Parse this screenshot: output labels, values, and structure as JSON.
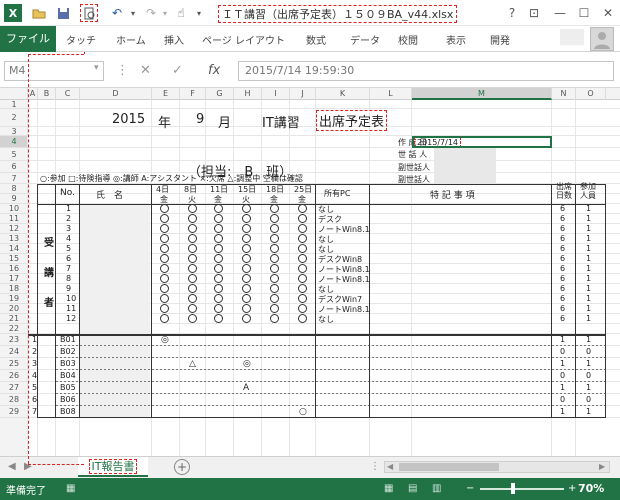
{
  "titlebar": {
    "title": "ＩＴ講習（出席予定表）１５０９BA_v44.xlsx",
    "help": "?",
    "ribbon_display": "⊡",
    "minimize": "—",
    "maximize": "☐",
    "close": "✕"
  },
  "quick_access": {
    "excel_icon": "X",
    "undo": "↶",
    "redo": "↷"
  },
  "ribbon": {
    "file": "ファイル",
    "tabs": [
      "タッチ",
      "ホーム",
      "挿入",
      "ページ レイアウト",
      "数式",
      "データ",
      "校閲",
      "表示",
      "開発"
    ]
  },
  "formula_bar": {
    "name_box": "M4",
    "fx": "fx",
    "value": "2015/7/14  19:59:30"
  },
  "columns": [
    "A",
    "B",
    "C",
    "D",
    "E",
    "F",
    "G",
    "H",
    "I",
    "J",
    "K",
    "L",
    "M",
    "N",
    "O"
  ],
  "rows": [
    "1",
    "2",
    "3",
    "4",
    "5",
    "6",
    "7",
    "8",
    "9",
    "10",
    "11",
    "12",
    "13",
    "14",
    "15",
    "16",
    "17",
    "18",
    "19",
    "20",
    "21",
    "22",
    "23",
    "24",
    "25",
    "26",
    "27",
    "28",
    "29"
  ],
  "sheet": {
    "year": "2015",
    "year_suffix": "年",
    "month": "9",
    "month_suffix": "月",
    "course": "IT講習",
    "schedule_title": "出席予定表",
    "tanto": "（担当:　B　班）",
    "info_labels": [
      "作 成 日",
      "世 話 人",
      "副世話人",
      "副世話人"
    ],
    "created_date": "2015/7/14",
    "legend": "○:参加 □:待険指導 ◎:講師 A:アシスタント ×:欠席 △:調整中 空欄は確認",
    "hdr_no": "No.",
    "hdr_name": "氏　名",
    "dates": [
      "4日",
      "8日",
      "11日",
      "15日",
      "18日",
      "25日"
    ],
    "weekdays": [
      "金",
      "火",
      "金",
      "火",
      "金",
      "金"
    ],
    "hdr_pc": "所有PC",
    "hdr_notes": "特 記 事 項",
    "hdr_attend": "出席\n日数",
    "hdr_join": "参加\n人員",
    "group_learners": [
      "受",
      "講",
      "者"
    ],
    "learner_nums": [
      "1",
      "2",
      "3",
      "4",
      "5",
      "6",
      "7",
      "8",
      "9",
      "10",
      "11",
      "12"
    ],
    "learner_pcs": [
      "なし",
      "デスク",
      "ノートWin8.1",
      "なし",
      "なし",
      "デスクWin8",
      "ノートWin8.1",
      "ノートWin8.1",
      "なし",
      "デスクWin7",
      "ノートWin8.1",
      "なし"
    ],
    "learner_attend": [
      "6",
      "6",
      "6",
      "6",
      "6",
      "6",
      "6",
      "6",
      "6",
      "6",
      "6",
      "6"
    ],
    "learner_join": [
      "1",
      "1",
      "1",
      "1",
      "1",
      "1",
      "1",
      "1",
      "1",
      "1",
      "1",
      "1"
    ],
    "staff_rownums": [
      "1",
      "2",
      "3",
      "4",
      "5",
      "6",
      "7"
    ],
    "staff_ids": [
      "B01",
      "B02",
      "B03",
      "B04",
      "B05",
      "B06",
      "B08"
    ],
    "staff_marks": [
      [
        "◎",
        "",
        "",
        "",
        "",
        ""
      ],
      [
        "",
        "",
        "",
        "",
        "",
        ""
      ],
      [
        "",
        "△",
        "",
        "◎",
        "",
        ""
      ],
      [
        "",
        "",
        "",
        "",
        "",
        ""
      ],
      [
        "",
        "",
        "",
        "A",
        "",
        ""
      ],
      [
        "",
        "",
        "",
        "",
        "",
        ""
      ],
      [
        "",
        "",
        "",
        "",
        "",
        "○"
      ]
    ],
    "staff_attend": [
      "1",
      "0",
      "1",
      "0",
      "1",
      "0",
      "1"
    ],
    "staff_join": [
      "1",
      "0",
      "1",
      "0",
      "1",
      "0",
      "1"
    ]
  },
  "sheet_tab": {
    "name": "IT報告書",
    "add": "+"
  },
  "statusbar": {
    "status": "準備完了",
    "zoom": "70%",
    "zoom_fraction": 0.7,
    "minus": "−",
    "plus": "+"
  },
  "colors": {
    "excel_green": "#217346",
    "highlight_red": "#dd2222"
  }
}
